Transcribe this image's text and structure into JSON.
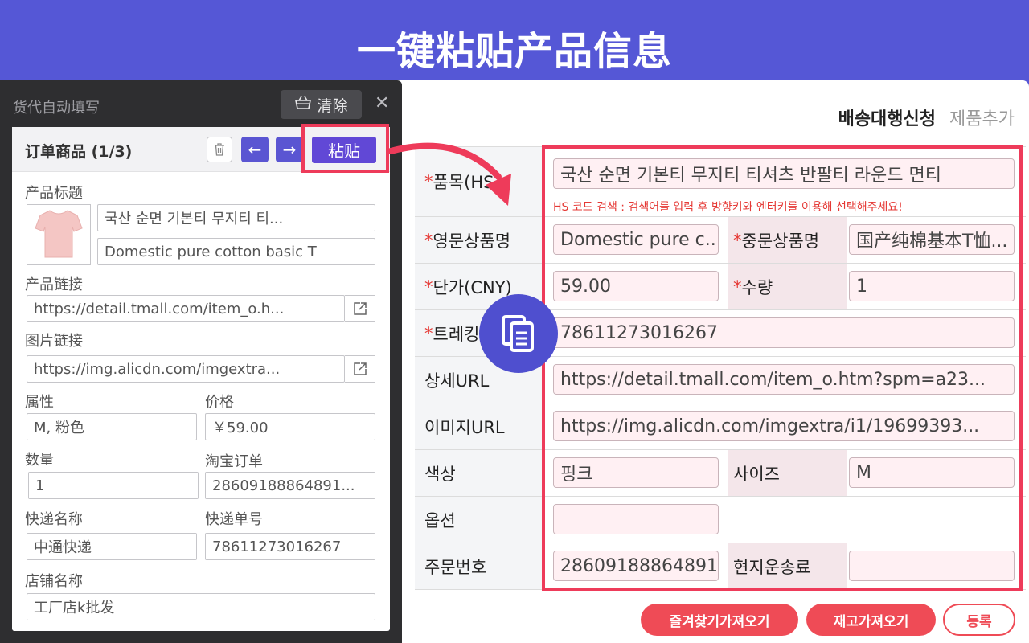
{
  "banner": {
    "title": "一键粘贴产品信息"
  },
  "ext": {
    "title": "货代自动填写",
    "clear_label": "清除",
    "card_title": "订单商品 (1/3)",
    "paste_label": "粘贴",
    "product_title_label": "产品标题",
    "product_title_cn": "국산 순면 기본티 무지티 티...",
    "product_title_en": "Domestic pure cotton basic T",
    "product_link_label": "产品链接",
    "product_link": "https://detail.tmall.com/item_o.h...",
    "image_link_label": "图片链接",
    "image_link": "https://img.alicdn.com/imgextra...",
    "attr_label": "属性",
    "attr_value": "M, 粉色",
    "price_label": "价格",
    "price_value": "￥59.00",
    "qty_label": "数量",
    "qty_value": "1",
    "taobao_order_label": "淘宝订单",
    "taobao_order_value": "28609188864891...",
    "courier_label": "快递名称",
    "courier_value": "中通快递",
    "tracking_label": "快递单号",
    "tracking_value": "78611273016267",
    "shop_label": "店铺名称",
    "shop_value": "工厂店k批发"
  },
  "form": {
    "tab_active": "배송대행신청",
    "tab_other": "제품추가",
    "labels": {
      "item": "품목(HS",
      "en_name": "영문상품명",
      "cn_name": "중문상품명",
      "price": "단가(CNY)",
      "qty": "수량",
      "tracking": "트레킹",
      "detail_url": "상세URL",
      "image_url": "이미지URL",
      "color": "색상",
      "size": "사이즈",
      "option": "옵션",
      "order_no": "주문번호",
      "local_shipping": "현지운송료"
    },
    "values": {
      "item": "국산 순면 기본티 무지티 티셔츠 반팔티 라운드 면티",
      "en_name": "Domestic pure c...",
      "cn_name": "国产纯棉基本T恤...",
      "price": "59.00",
      "qty": "1",
      "tracking": "78611273016267",
      "detail_url": "https://detail.tmall.com/item_o.htm?spm=a23...",
      "image_url": "https://img.alicdn.com/imgextra/i1/19699393...",
      "color": "핑크",
      "size": "M",
      "option": "",
      "order_no": "28609188864891",
      "local_shipping": ""
    },
    "hs_hint": "HS 코드 검색 : 검색어를 입력 후 방향키와 엔터키를 이용해 선택해주세요!",
    "btn_favorites": "즐겨찾기가져오기",
    "btn_stock": "재고가져오기",
    "btn_register": "등록"
  },
  "colors": {
    "banner_bg": "#5557d6",
    "accent_red": "#ee3b5a",
    "button_purple": "#6148d6"
  },
  "icons": [
    "basket-icon",
    "close-icon",
    "trash-icon",
    "arrow-left-icon",
    "arrow-right-icon",
    "external-link-icon",
    "tshirt-icon",
    "paste-clipboard-icon",
    "curved-arrow-icon"
  ]
}
